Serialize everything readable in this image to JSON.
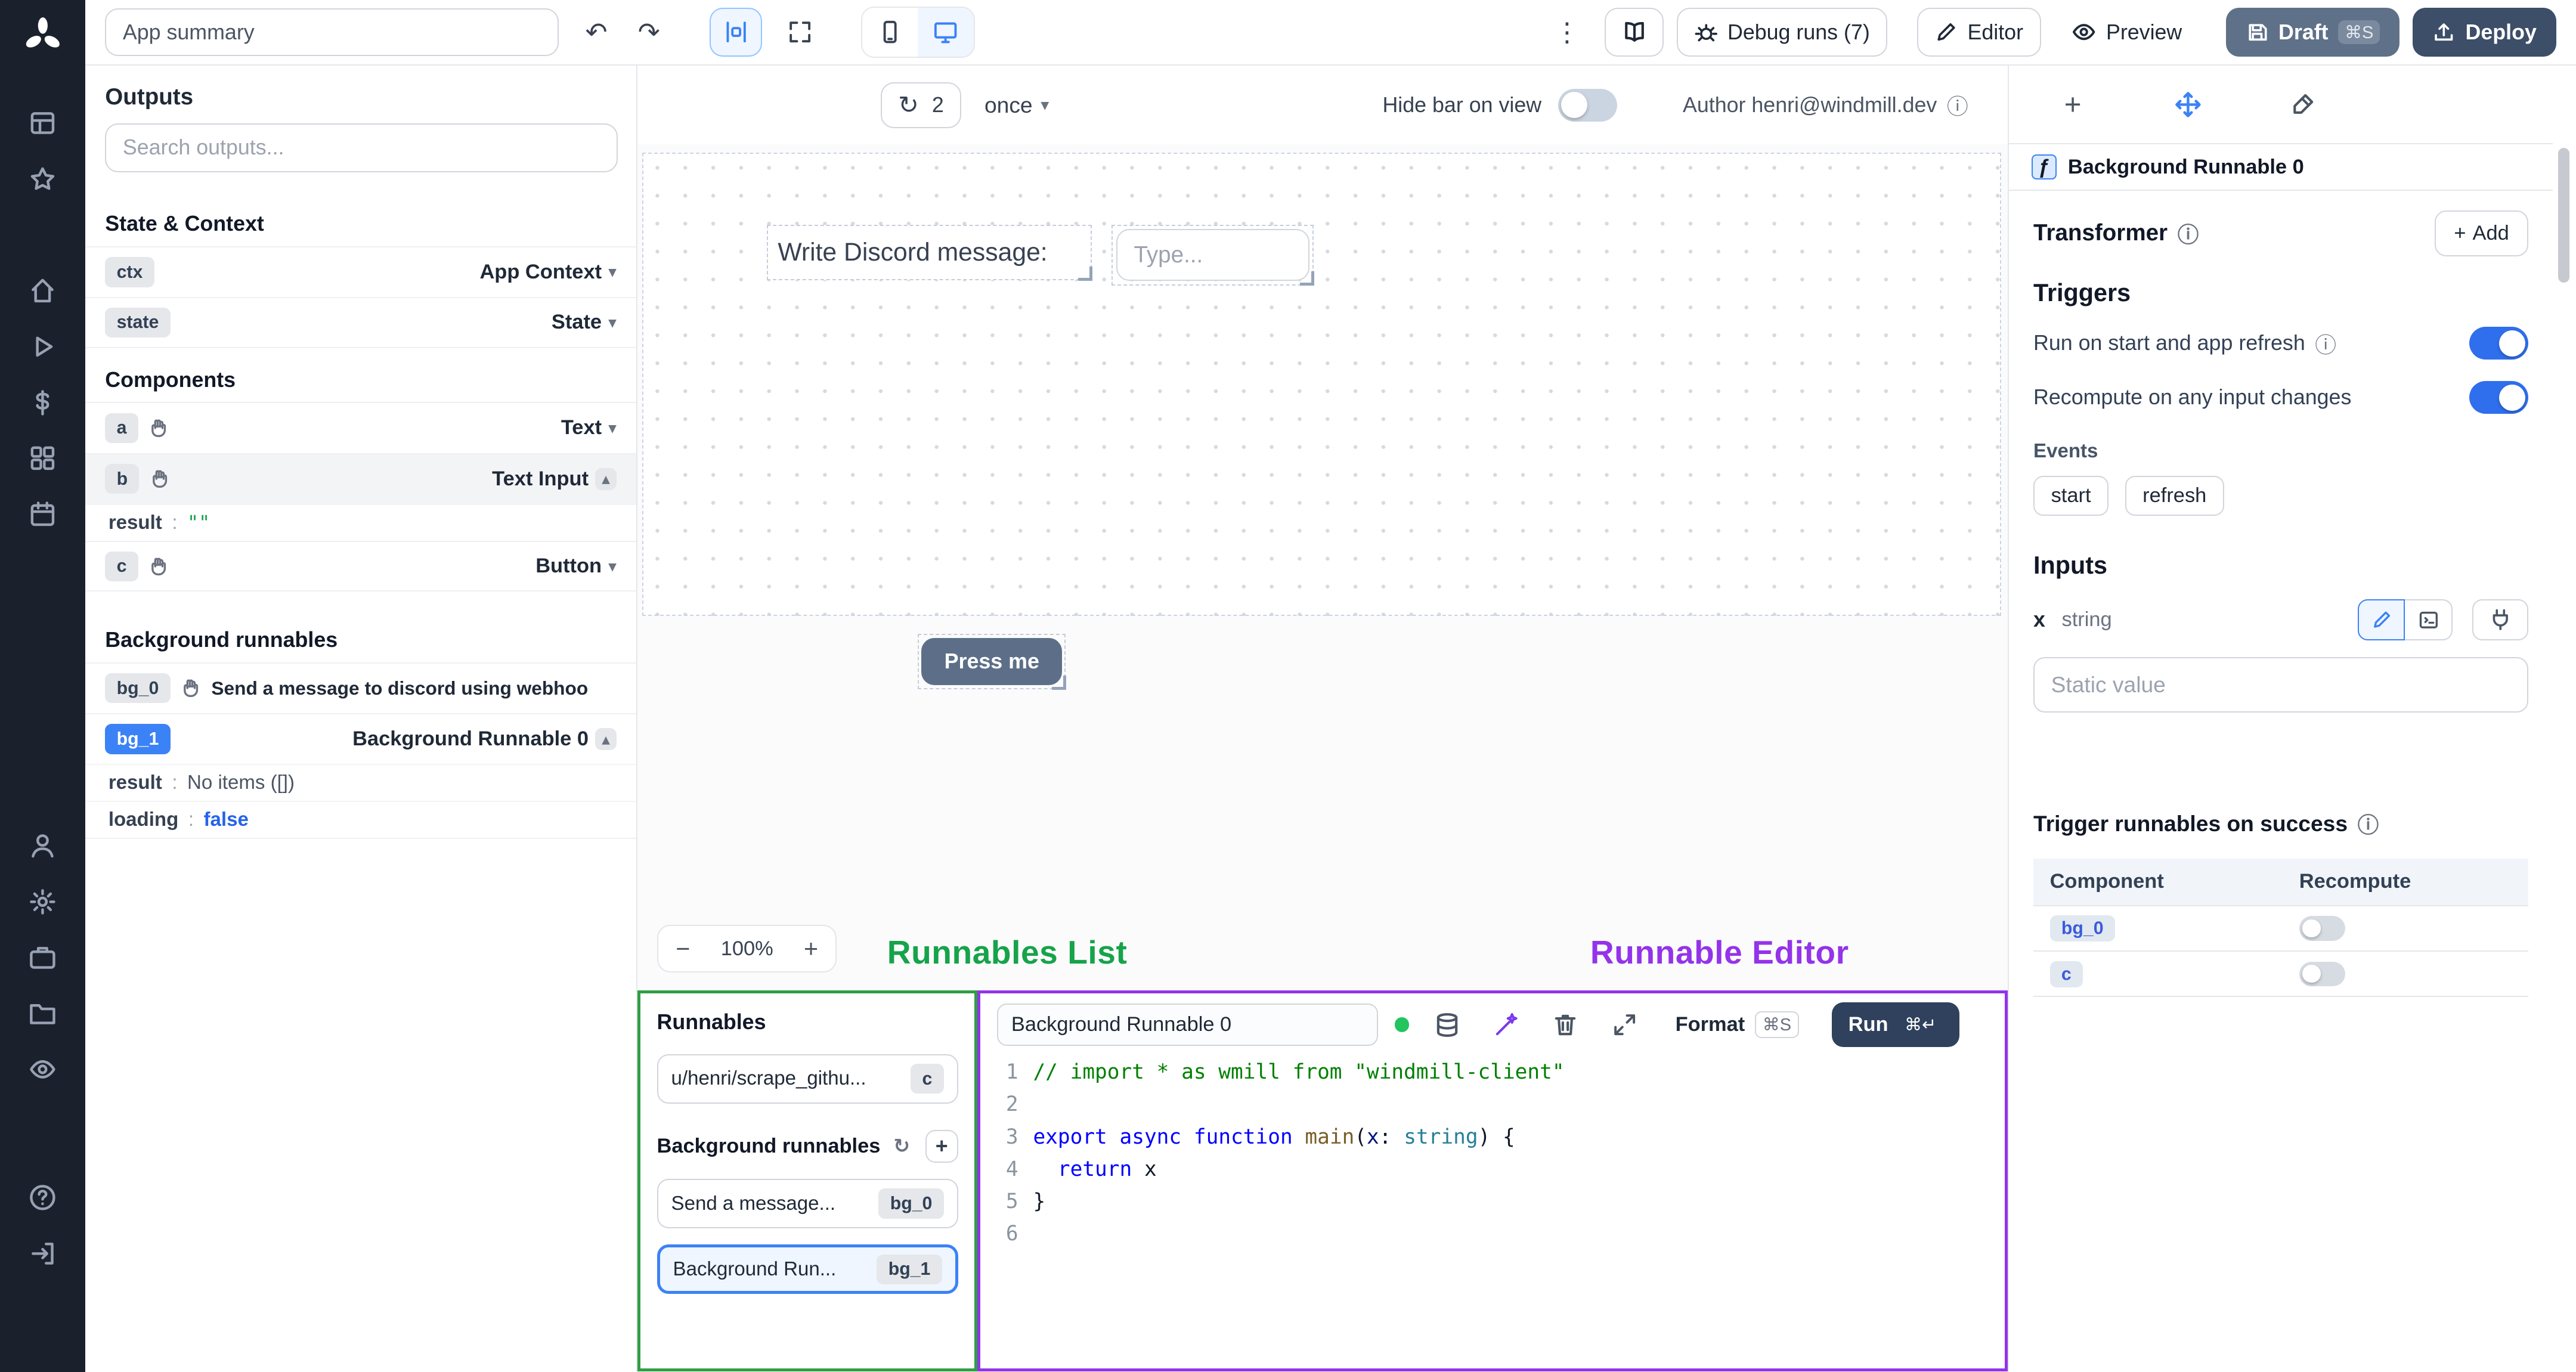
{
  "colors": {
    "accent": "#3b82f6",
    "runnables_highlight": "#2f9e44",
    "editor_highlight": "#9333ea",
    "toggle_on": "#2f6fed"
  },
  "icons": {
    "undo": "↶",
    "redo": "↷",
    "kebab": "⋮",
    "refresh": "↻",
    "chev_down": "▾",
    "chev_up": "▴",
    "info": "ⓘ",
    "plus": "+",
    "minus": "−"
  },
  "topbar": {
    "app_summary": "App summary",
    "debug_runs_label": "Debug runs (7)",
    "editor_label": "Editor",
    "preview_label": "Preview",
    "draft_label": "Draft",
    "draft_kbd": "⌘S",
    "deploy_label": "Deploy"
  },
  "outputs": {
    "title": "Outputs",
    "search_placeholder": "Search outputs...",
    "state_context_title": "State & Context",
    "ctx": {
      "key": "ctx",
      "type": "App Context"
    },
    "state": {
      "key": "state",
      "type": "State"
    },
    "components_title": "Components",
    "a": {
      "key": "a",
      "type": "Text"
    },
    "b": {
      "key": "b",
      "type": "Text Input",
      "result_label": "result",
      "result_value": "\"\""
    },
    "c": {
      "key": "c",
      "type": "Button"
    },
    "background_title": "Background runnables",
    "bg0": {
      "key": "bg_0",
      "title": "Send a message to discord using webhoo"
    },
    "bg1": {
      "key": "bg_1",
      "title": "Background Runnable 0",
      "result_label": "result",
      "result_value": "No items ([])",
      "loading_label": "loading",
      "loading_value": "false"
    }
  },
  "canvas": {
    "refresh_count": "2",
    "interval_label": "once",
    "hide_bar_label": "Hide bar on view",
    "author_label": "Author henri@windmill.dev",
    "text_component": "Write Discord message:",
    "input_placeholder": "Type...",
    "button_label": "Press me",
    "zoom_out": "−",
    "zoom_level": "100%",
    "zoom_in": "+"
  },
  "annotations": {
    "runnables_list": "Runnables List",
    "runnable_editor": "Runnable Editor"
  },
  "runnables_panel": {
    "title": "Runnables",
    "item_script": {
      "label": "u/henri/scrape_githu...",
      "badge": "c"
    },
    "bg_section": "Background runnables",
    "item_bg0": {
      "label": "Send a message...",
      "badge": "bg_0"
    },
    "item_bg1": {
      "label": "Background Run...",
      "badge": "bg_1"
    }
  },
  "editor_panel": {
    "name_value": "Background Runnable 0",
    "format_label": "Format",
    "format_kbd": "⌘S",
    "run_label": "Run",
    "run_kbd": "⌘↵",
    "code_lines": [
      [
        [
          "// import * as wmill from \"windmill-client\"",
          "comment"
        ]
      ],
      [],
      [
        [
          "export",
          "kw"
        ],
        [
          " ",
          "plain"
        ],
        [
          "async",
          "kw"
        ],
        [
          " ",
          "plain"
        ],
        [
          "function",
          "kw"
        ],
        [
          " ",
          "plain"
        ],
        [
          "main",
          "fn"
        ],
        [
          "(",
          "plain"
        ],
        [
          "x",
          "param"
        ],
        [
          ": ",
          "plain"
        ],
        [
          "string",
          "type"
        ],
        [
          ") {",
          "plain"
        ]
      ],
      [
        [
          "  ",
          "plain"
        ],
        [
          "return",
          "kw"
        ],
        [
          " x",
          "plain"
        ]
      ],
      [
        [
          "}",
          "plain"
        ]
      ],
      []
    ]
  },
  "inspector": {
    "header": "Background Runnable 0",
    "transformer_label": "Transformer",
    "add_label": "Add",
    "triggers_title": "Triggers",
    "trigger_run_on_start": "Run on start and app refresh",
    "trigger_recompute": "Recompute on any input changes",
    "events_label": "Events",
    "event_chips": [
      "start",
      "refresh"
    ],
    "inputs_title": "Inputs",
    "input_name": "x",
    "input_type": "string",
    "static_placeholder": "Static value",
    "success_title": "Trigger runnables on success",
    "table": {
      "col_component": "Component",
      "col_recompute": "Recompute",
      "rows": [
        {
          "badge": "bg_0"
        },
        {
          "badge": "c"
        }
      ]
    }
  }
}
